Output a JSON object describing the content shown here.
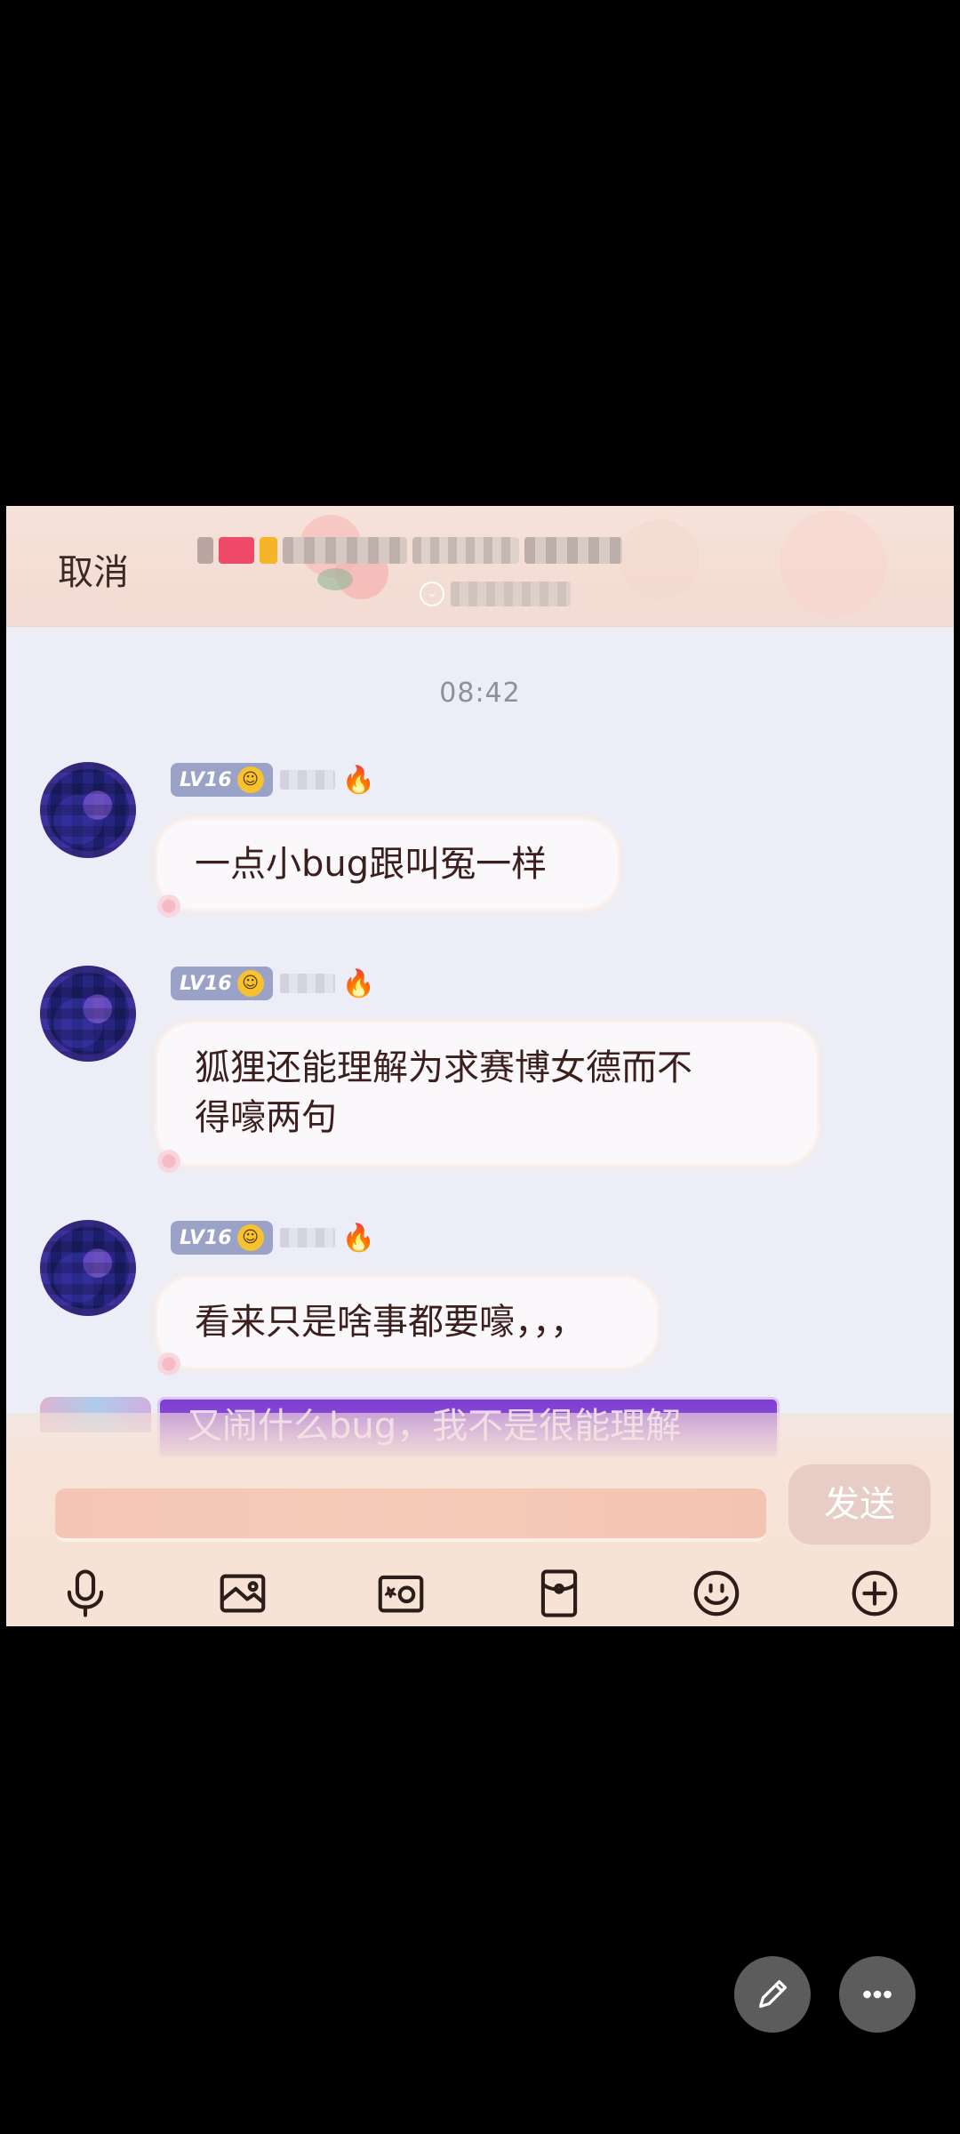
{
  "header": {
    "cancel_label": "取消"
  },
  "chat": {
    "timestamp": "08:42",
    "messages": [
      {
        "level": "LV16",
        "text": "一点小bug跟叫冤一样"
      },
      {
        "level": "LV16",
        "text_line1": "狐狸还能理解为求赛博女德而不",
        "text_line2": "得嚎两句"
      },
      {
        "level": "LV16",
        "text": "看来只是啥事都要嚎，，，"
      }
    ],
    "partial_message": "又闹什么bug，我不是很能理解"
  },
  "input": {
    "send_label": "发送"
  },
  "toolbar": {
    "icons": [
      "microphone-icon",
      "image-icon",
      "camera-icon",
      "red-packet-icon",
      "emoji-icon",
      "plus-icon"
    ]
  },
  "floating": {
    "icons": [
      "edit-icon",
      "more-icon"
    ]
  }
}
